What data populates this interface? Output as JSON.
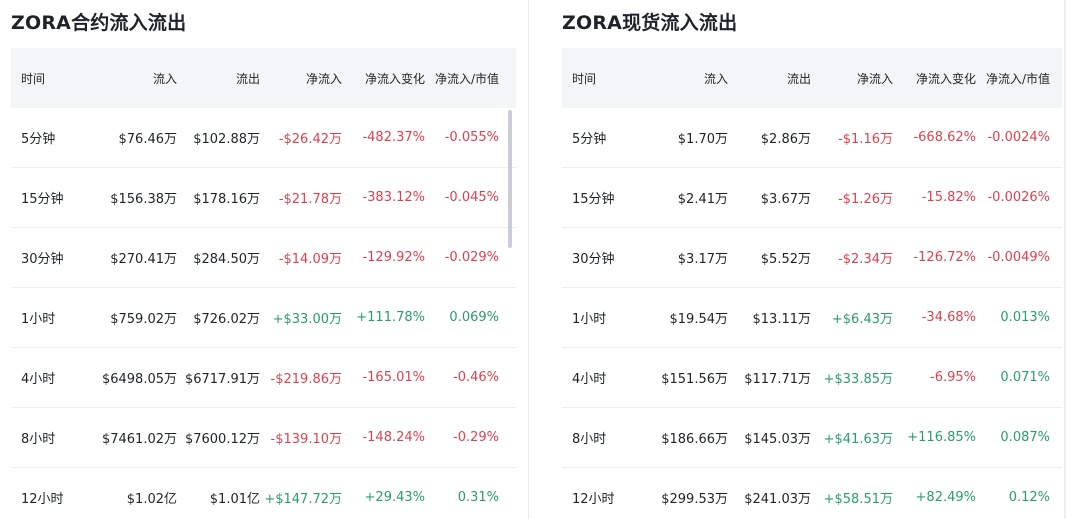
{
  "colors": {
    "positive": "#2a9d6f",
    "negative": "#e0404e",
    "header_bg": "#f3f5f7"
  },
  "contract": {
    "title": "ZORA合约流入流出",
    "headers": [
      "时间",
      "流入",
      "流出",
      "净流入",
      "净流入变化",
      "净流入/市值"
    ],
    "rows": [
      {
        "period": "5分钟",
        "inflow": "$76.46万",
        "outflow": "$102.88万",
        "net": "-$26.42万",
        "change": "-482.37%",
        "ratio": "-0.055%",
        "dir": "neg"
      },
      {
        "period": "15分钟",
        "inflow": "$156.38万",
        "outflow": "$178.16万",
        "net": "-$21.78万",
        "change": "-383.12%",
        "ratio": "-0.045%",
        "dir": "neg"
      },
      {
        "period": "30分钟",
        "inflow": "$270.41万",
        "outflow": "$284.50万",
        "net": "-$14.09万",
        "change": "-129.92%",
        "ratio": "-0.029%",
        "dir": "neg"
      },
      {
        "period": "1小时",
        "inflow": "$759.02万",
        "outflow": "$726.02万",
        "net": "+$33.00万",
        "change": "+111.78%",
        "ratio": "0.069%",
        "dir": "pos"
      },
      {
        "period": "4小时",
        "inflow": "$6498.05万",
        "outflow": "$6717.91万",
        "net": "-$219.86万",
        "change": "-165.01%",
        "ratio": "-0.46%",
        "dir": "neg"
      },
      {
        "period": "8小时",
        "inflow": "$7461.02万",
        "outflow": "$7600.12万",
        "net": "-$139.10万",
        "change": "-148.24%",
        "ratio": "-0.29%",
        "dir": "neg"
      },
      {
        "period": "12小时",
        "inflow": "$1.02亿",
        "outflow": "$1.01亿",
        "net": "+$147.72万",
        "change": "+29.43%",
        "ratio": "0.31%",
        "dir": "pos"
      }
    ]
  },
  "spot": {
    "title": "ZORA现货流入流出",
    "headers": [
      "时间",
      "流入",
      "流出",
      "净流入",
      "净流入变化",
      "净流入/市值"
    ],
    "rows": [
      {
        "period": "5分钟",
        "inflow": "$1.70万",
        "outflow": "$2.86万",
        "net": "-$1.16万",
        "change": "-668.62%",
        "ratio": "-0.0024%",
        "dir": "neg",
        "change_dir": "neg"
      },
      {
        "period": "15分钟",
        "inflow": "$2.41万",
        "outflow": "$3.67万",
        "net": "-$1.26万",
        "change": "-15.82%",
        "ratio": "-0.0026%",
        "dir": "neg",
        "change_dir": "neg"
      },
      {
        "period": "30分钟",
        "inflow": "$3.17万",
        "outflow": "$5.52万",
        "net": "-$2.34万",
        "change": "-126.72%",
        "ratio": "-0.0049%",
        "dir": "neg",
        "change_dir": "neg"
      },
      {
        "period": "1小时",
        "inflow": "$19.54万",
        "outflow": "$13.11万",
        "net": "+$6.43万",
        "change": "-34.68%",
        "ratio": "0.013%",
        "dir": "pos",
        "change_dir": "neg"
      },
      {
        "period": "4小时",
        "inflow": "$151.56万",
        "outflow": "$117.71万",
        "net": "+$33.85万",
        "change": "-6.95%",
        "ratio": "0.071%",
        "dir": "pos",
        "change_dir": "neg"
      },
      {
        "period": "8小时",
        "inflow": "$186.66万",
        "outflow": "$145.03万",
        "net": "+$41.63万",
        "change": "+116.85%",
        "ratio": "0.087%",
        "dir": "pos",
        "change_dir": "pos"
      },
      {
        "period": "12小时",
        "inflow": "$299.53万",
        "outflow": "$241.03万",
        "net": "+$58.51万",
        "change": "+82.49%",
        "ratio": "0.12%",
        "dir": "pos",
        "change_dir": "pos"
      }
    ]
  }
}
